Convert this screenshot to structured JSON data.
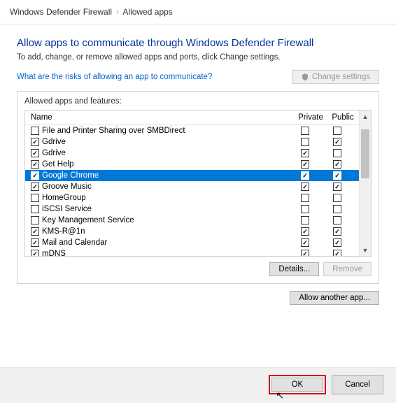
{
  "breadcrumb": {
    "root": "Windows Defender Firewall",
    "current": "Allowed apps"
  },
  "title": "Allow apps to communicate through Windows Defender Firewall",
  "subtitle": "To add, change, or remove allowed apps and ports, click Change settings.",
  "risk_link": "What are the risks of allowing an app to communicate?",
  "change_settings_label": "Change settings",
  "group_label": "Allowed apps and features:",
  "columns": {
    "name": "Name",
    "private": "Private",
    "public": "Public"
  },
  "apps": [
    {
      "enabled": false,
      "name": "File and Printer Sharing over SMBDirect",
      "private": false,
      "public": false,
      "selected": false
    },
    {
      "enabled": true,
      "name": "Gdrive",
      "private": false,
      "public": true,
      "selected": false
    },
    {
      "enabled": true,
      "name": "Gdrive",
      "private": true,
      "public": false,
      "selected": false
    },
    {
      "enabled": true,
      "name": "Get Help",
      "private": true,
      "public": true,
      "selected": false
    },
    {
      "enabled": true,
      "name": "Google Chrome",
      "private": true,
      "public": true,
      "selected": true
    },
    {
      "enabled": true,
      "name": "Groove Music",
      "private": true,
      "public": true,
      "selected": false
    },
    {
      "enabled": false,
      "name": "HomeGroup",
      "private": false,
      "public": false,
      "selected": false
    },
    {
      "enabled": false,
      "name": "iSCSI Service",
      "private": false,
      "public": false,
      "selected": false
    },
    {
      "enabled": false,
      "name": "Key Management Service",
      "private": false,
      "public": false,
      "selected": false
    },
    {
      "enabled": true,
      "name": "KMS-R@1n",
      "private": true,
      "public": true,
      "selected": false
    },
    {
      "enabled": true,
      "name": "Mail and Calendar",
      "private": true,
      "public": true,
      "selected": false
    },
    {
      "enabled": true,
      "name": "mDNS",
      "private": true,
      "public": true,
      "selected": false
    }
  ],
  "buttons": {
    "details": "Details...",
    "remove": "Remove",
    "allow_another": "Allow another app...",
    "ok": "OK",
    "cancel": "Cancel"
  }
}
